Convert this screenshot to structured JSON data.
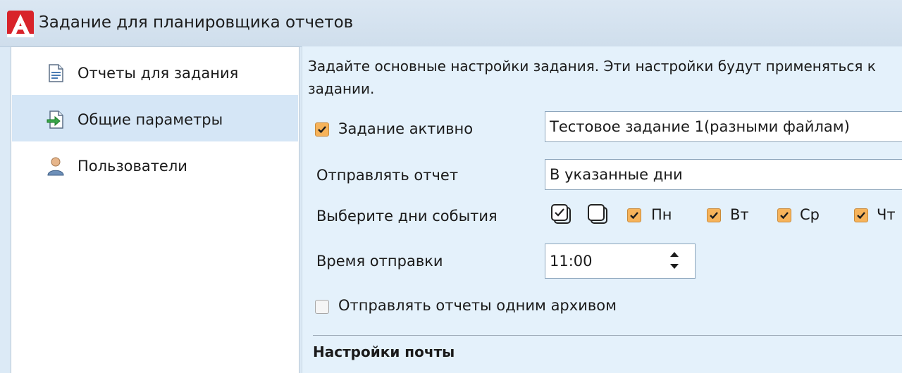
{
  "window": {
    "title": "Задание для планировщика отчетов"
  },
  "nav": {
    "items": [
      {
        "label": "Отчеты для задания",
        "icon": "report-document-icon",
        "selected": false
      },
      {
        "label": "Общие параметры",
        "icon": "general-settings-icon",
        "selected": true
      },
      {
        "label": "Пользователи",
        "icon": "user-icon",
        "selected": false
      }
    ]
  },
  "main": {
    "description": "Задайте основные настройки задания. Эти настройки будут применяться к задании.",
    "task_active": {
      "label": "Задание активно",
      "checked": true,
      "name_value": "Тестовое задание 1(разными файлам)"
    },
    "send_report": {
      "label": "Отправлять отчет",
      "value": "В указанные дни"
    },
    "days": {
      "label": "Выберите дни события",
      "select_all_icon": "select-all-icon",
      "deselect_all_icon": "deselect-all-icon",
      "items": [
        {
          "label": "Пн",
          "checked": true
        },
        {
          "label": "Вт",
          "checked": true
        },
        {
          "label": "Ср",
          "checked": true
        },
        {
          "label": "Чт",
          "checked": true
        }
      ]
    },
    "send_time": {
      "label": "Время отправки",
      "value": "11:00"
    },
    "single_archive": {
      "label": "Отправлять отчеты одним архивом",
      "checked": false
    },
    "mail_section": {
      "title": "Настройки почты"
    }
  },
  "colors": {
    "checkbox_checked": "#f6b35a",
    "selected_nav": "#d5e6f6",
    "content_bg": "#e4f1fb",
    "logo_red": "#d8232a"
  }
}
